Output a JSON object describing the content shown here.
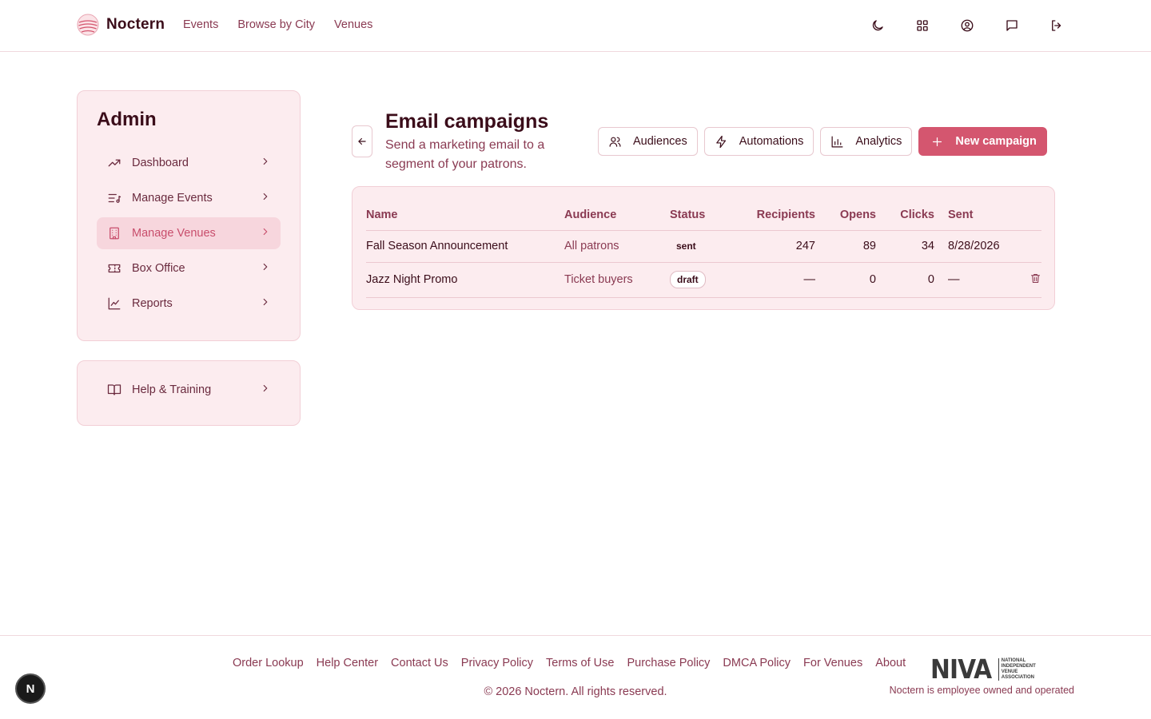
{
  "header": {
    "brand": "Noctern",
    "nav": [
      "Events",
      "Browse by City",
      "Venues"
    ],
    "icons": [
      "moon-icon",
      "grid-icon",
      "user-circle-icon",
      "message-icon",
      "logout-icon"
    ]
  },
  "sidebar": {
    "title": "Admin",
    "items": [
      {
        "label": "Dashboard",
        "icon": "trending-up-icon",
        "active": false
      },
      {
        "label": "Manage Events",
        "icon": "list-music-icon",
        "active": false
      },
      {
        "label": "Manage Venues",
        "icon": "building-icon",
        "active": true
      },
      {
        "label": "Box Office",
        "icon": "ticket-icon",
        "active": false
      },
      {
        "label": "Reports",
        "icon": "line-chart-icon",
        "active": false
      }
    ],
    "help": {
      "label": "Help & Training",
      "icon": "book-icon"
    }
  },
  "main": {
    "title": "Email campaigns",
    "subtitle": "Send a marketing email to a segment of your patrons.",
    "buttons": {
      "audiences": "Audiences",
      "automations": "Automations",
      "analytics": "Analytics",
      "new_campaign": "New campaign"
    },
    "table": {
      "headers": [
        "Name",
        "Audience",
        "Status",
        "Recipients",
        "Opens",
        "Clicks",
        "Sent"
      ],
      "rows": [
        {
          "name": "Fall Season Announcement",
          "audience": "All patrons",
          "status": "sent",
          "recipients": "247",
          "opens": "89",
          "clicks": "34",
          "sent": "8/28/2026"
        },
        {
          "name": "Jazz Night Promo",
          "audience": "Ticket buyers",
          "status": "draft",
          "recipients": "—",
          "opens": "0",
          "clicks": "0",
          "sent": "—"
        }
      ]
    }
  },
  "footer": {
    "links": [
      "Order Lookup",
      "Help Center",
      "Contact Us",
      "Privacy Policy",
      "Terms of Use",
      "Purchase Policy",
      "DMCA Policy",
      "For Venues",
      "About"
    ],
    "copyright": "© 2026 Noctern. All rights reserved.",
    "niva_mark": "NIVA",
    "niva_text": [
      "NATIONAL",
      "INDEPENDENT",
      "VENUE",
      "ASSOCIATION"
    ],
    "employee_note": "Noctern is employee owned and operated"
  },
  "dev_badge": "N",
  "colors": {
    "accent": "#d4566f",
    "card_bg": "#fcecef",
    "text": "#3b0d1a",
    "muted": "#8a3a52"
  }
}
